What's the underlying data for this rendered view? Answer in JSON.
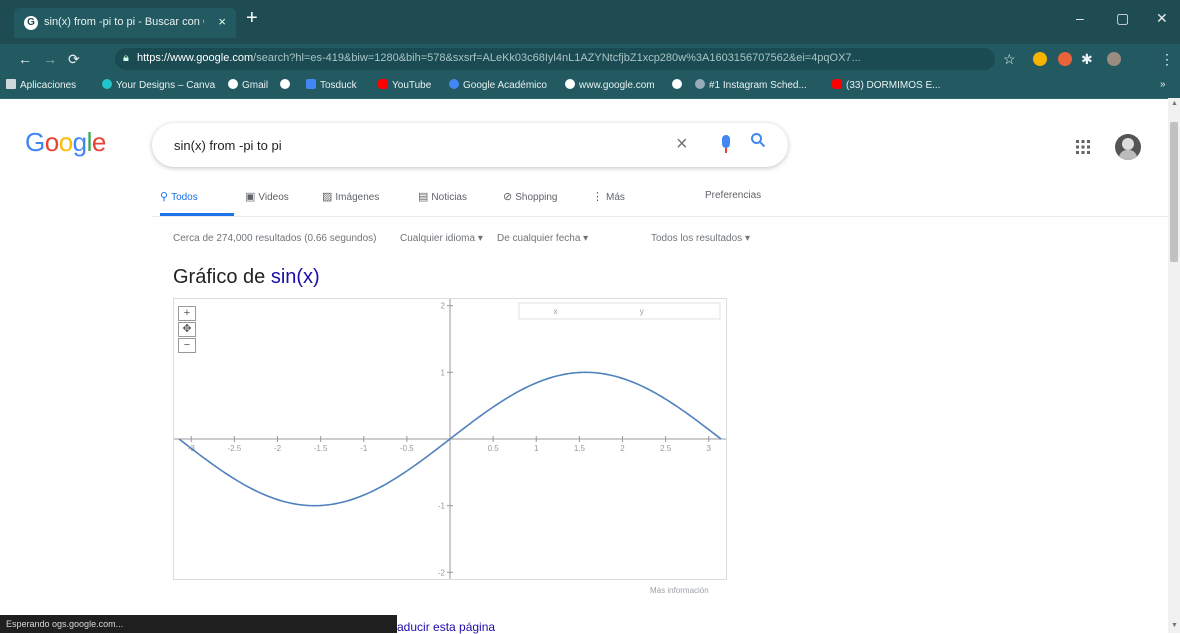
{
  "browser": {
    "tab_title": "sin(x) from -pi to pi - Buscar con G",
    "favicon": "G",
    "tab_close": "×",
    "new_tab": "+",
    "window": {
      "minimize": "–",
      "maximize": "▢",
      "close": "✕"
    },
    "url_host": "https://www.google.com",
    "url_rest": "/search?hl=es-419&biw=1280&bih=578&sxsrf=ALeKk03c68Iyl4nL1AZYNtcfjbZ1xcp280w%3A1603156707562&ei=4pqOX7...",
    "bookmarks": [
      {
        "label": "Aplicaciones",
        "color": "#cfd8dc"
      },
      {
        "label": "Your Designs – Canva",
        "color": "#20c4cb"
      },
      {
        "label": "Gmail",
        "color": "#ffffff"
      },
      {
        "label": "",
        "color": "#ffffff"
      },
      {
        "label": "Tosduck",
        "color": "#4285f4"
      },
      {
        "label": "YouTube",
        "color": "#ff0000"
      },
      {
        "label": "Google Académico",
        "color": "#4285f4"
      },
      {
        "label": "www.google.com",
        "color": "#ffffff"
      },
      {
        "label": "",
        "color": "#ffffff"
      },
      {
        "label": "#1 Instagram Sched...",
        "color": "#9ab"
      },
      {
        "label": "(33) DORMIMOS E...",
        "color": "#ff0000"
      }
    ]
  },
  "google": {
    "logo": [
      "G",
      "o",
      "o",
      "g",
      "l",
      "e"
    ],
    "logo_colors": [
      "#4285f4",
      "#ea4335",
      "#fbbc05",
      "#4285f4",
      "#34a853",
      "#ea4335"
    ],
    "query": "sin(x) from -pi to pi",
    "clear": "×",
    "search_glyph": "⚲",
    "apps_glyph": "⋮⋮⋮"
  },
  "search_tabs": [
    {
      "label": "Todos",
      "icon": "⚲"
    },
    {
      "label": "Videos",
      "icon": "▣"
    },
    {
      "label": "Imágenes",
      "icon": "▨"
    },
    {
      "label": "Noticias",
      "icon": "▤"
    },
    {
      "label": "Shopping",
      "icon": "⊘"
    },
    {
      "label": "Más",
      "icon": "⋮"
    },
    {
      "label": "Preferencias",
      "icon": ""
    }
  ],
  "results": {
    "stats": "Cerca de 274,000 resultados (0.66 segundos)",
    "filters": [
      "Cualquier idioma ▾",
      "De cualquier fecha ▾",
      "Todos los resultados ▾"
    ]
  },
  "graph": {
    "title_prefix": "Gráfico de ",
    "function": "sin(x)",
    "zoom_in": "+",
    "zoom_out": "−",
    "zoom_pan": "✥",
    "more_info": "Más información",
    "readout_x": "x",
    "readout_y": "y"
  },
  "chart_data": {
    "type": "line",
    "function": "sin(x)",
    "xlim": [
      -3.2,
      3.2
    ],
    "ylim": [
      -2.1,
      2.1
    ],
    "x_ticks": [
      -3,
      -2.5,
      -2,
      -1.5,
      -1,
      -0.5,
      0.5,
      1,
      1.5,
      2,
      2.5,
      3
    ],
    "x_tick_labels": [
      "-3",
      "-2.5",
      "-2",
      "-1.5",
      "-1",
      "-0.5",
      "0.5",
      "1",
      "1.5",
      "2",
      "2.5",
      "3"
    ],
    "y_ticks": [
      -2,
      -1,
      1,
      2
    ],
    "y_tick_labels": [
      "-2",
      "-1",
      "1",
      "2"
    ],
    "domain": [
      -3.14159,
      3.14159
    ],
    "series": [
      {
        "color": "#4f81bd"
      }
    ]
  },
  "status": {
    "loading": "Esperando ogs.google.com...",
    "translate_link": "aducir esta página"
  }
}
